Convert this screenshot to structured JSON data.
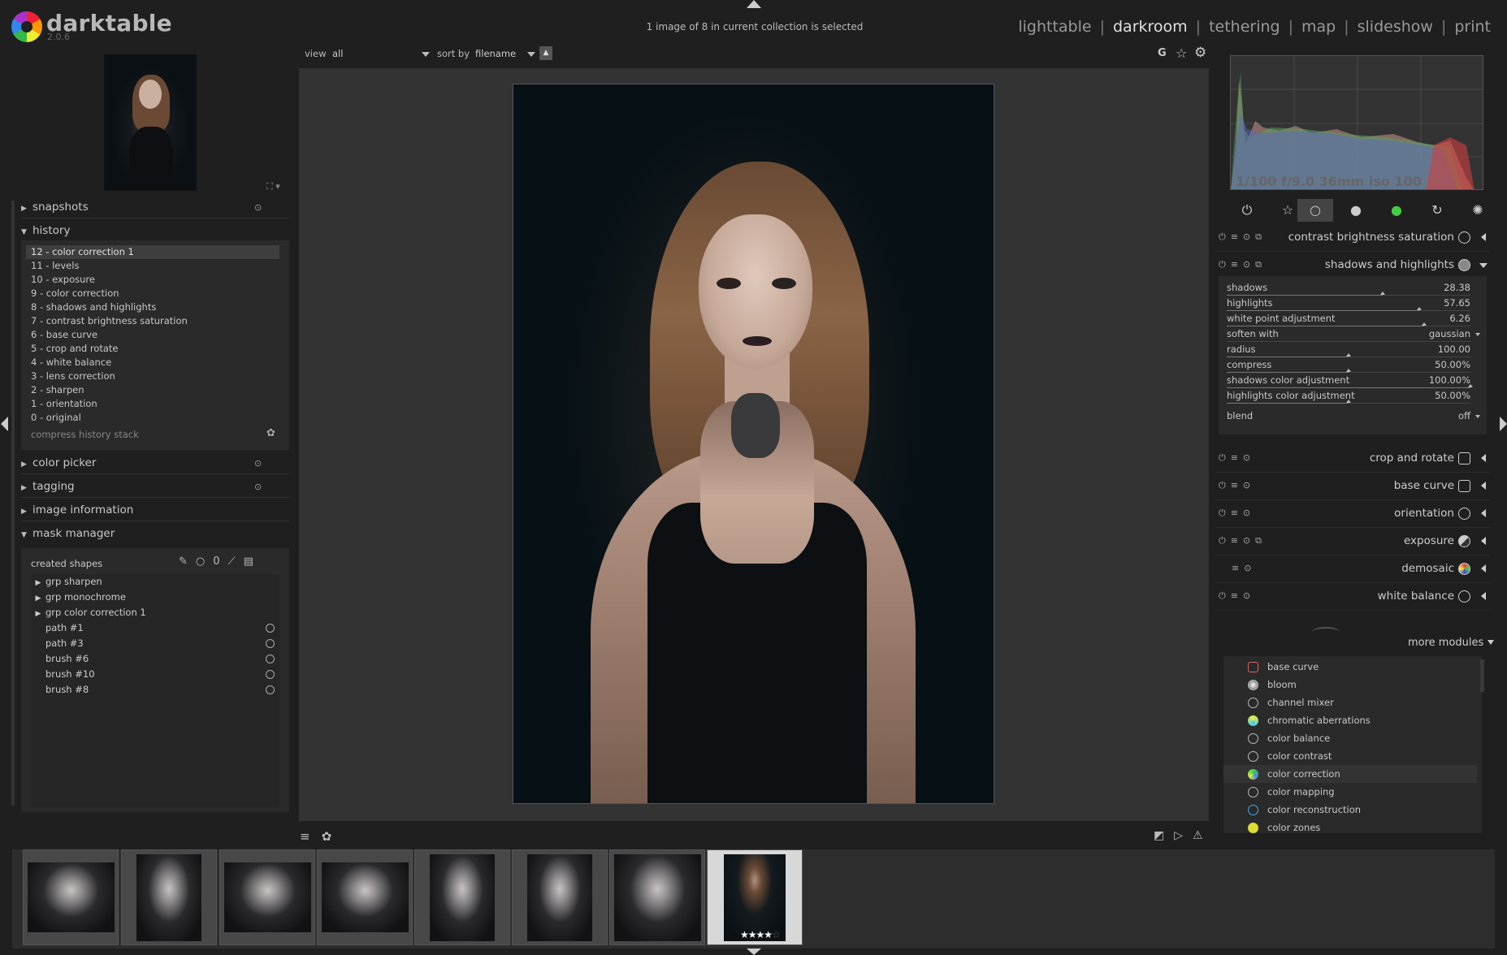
{
  "app": {
    "name": "darktable",
    "version": "2.0.6"
  },
  "collection_status": "1 image of 8 in current collection is selected",
  "views": [
    "lighttable",
    "darkroom",
    "tethering",
    "map",
    "slideshow",
    "print"
  ],
  "active_view": "darkroom",
  "left_panel": {
    "snapshots_label": "snapshots",
    "history_label": "history",
    "history_items": [
      "12 - color correction 1",
      "11 - levels",
      "10 - exposure",
      "9 - color correction",
      "8 - shadows and highlights",
      "7 - contrast brightness saturation",
      "6 - base curve",
      "5 - crop and rotate",
      "4 - white balance",
      "3 - lens correction",
      "2 - sharpen",
      "1 - orientation",
      "0 - original"
    ],
    "history_selected": "12 - color correction 1",
    "compress_label": "compress history stack",
    "color_picker_label": "color picker",
    "tagging_label": "tagging",
    "image_information_label": "image information",
    "mask_manager_label": "mask manager",
    "created_shapes_label": "created shapes",
    "mask_groups": [
      "grp sharpen",
      "grp monochrome",
      "grp color correction 1"
    ],
    "mask_shapes": [
      "path #1",
      "path #3",
      "brush #6",
      "brush #10",
      "brush #8"
    ]
  },
  "toolbar": {
    "view_label": "view",
    "view_value": "all",
    "sort_label": "sort by",
    "sort_value": "filename",
    "sort_direction": "▲",
    "grouping_label": "G"
  },
  "histogram": {
    "exif": "1/100 f/9.0 36mm iso 100"
  },
  "modules_active": [
    {
      "name": "contrast brightness saturation",
      "icon": "color-wheel-icon",
      "expanded": false
    },
    {
      "name": "shadows and highlights",
      "icon": "half-sphere-icon",
      "expanded": true
    },
    {
      "name": "crop and rotate",
      "icon": "crop-icon",
      "expanded": false
    },
    {
      "name": "base curve",
      "icon": "curve-icon",
      "expanded": false
    },
    {
      "name": "orientation",
      "icon": "rotate-icon",
      "expanded": false
    },
    {
      "name": "exposure",
      "icon": "exposure-icon",
      "expanded": false
    },
    {
      "name": "demosaic",
      "icon": "demosaic-icon",
      "expanded": false
    },
    {
      "name": "white balance",
      "icon": "thermometer-icon",
      "expanded": false
    }
  ],
  "shadows_highlights": {
    "sliders": [
      {
        "label": "shadows",
        "value": "28.38",
        "level": 0.64
      },
      {
        "label": "highlights",
        "value": "57.65",
        "level": 0.79
      },
      {
        "label": "white point adjustment",
        "value": "6.26",
        "level": 0.81
      },
      {
        "label": "soften with",
        "value": "gaussian",
        "dropdown": true
      },
      {
        "label": "radius",
        "value": "100.00",
        "level": 0.5
      },
      {
        "label": "compress",
        "value": "50.00%",
        "level": 0.5
      },
      {
        "label": "shadows color adjustment",
        "value": "100.00%",
        "level": 1.0
      },
      {
        "label": "highlights color adjustment",
        "value": "50.00%",
        "level": 0.5
      }
    ],
    "blend_label": "blend",
    "blend_value": "off"
  },
  "more_modules_label": "more modules",
  "more_modules": [
    "base curve",
    "bloom",
    "channel mixer",
    "chromatic aberrations",
    "color balance",
    "color contrast",
    "color correction",
    "color mapping",
    "color reconstruction",
    "color zones"
  ],
  "more_modules_selected": "color correction",
  "filmstrip": {
    "count": 8,
    "selected_index": 7,
    "selected_rating": 4
  }
}
